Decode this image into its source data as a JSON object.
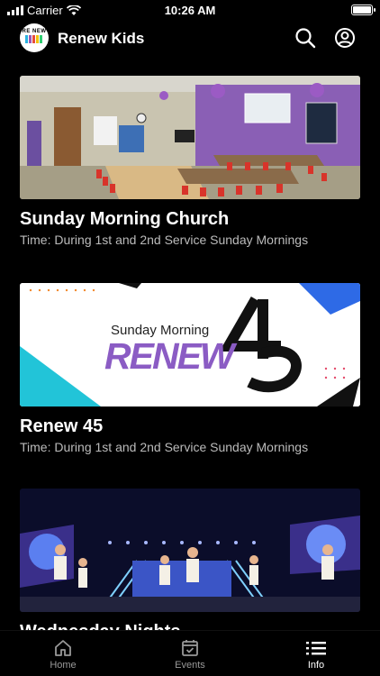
{
  "status": {
    "carrier": "Carrier",
    "time": "10:26 AM"
  },
  "header": {
    "logo_text": "RE NEW",
    "title": "Renew Kids",
    "search_icon": "search-icon",
    "account_icon": "account-icon"
  },
  "cards": [
    {
      "title": "Sunday Morning Church",
      "subtitle": "Time: During 1st and 2nd Service Sunday Mornings"
    },
    {
      "title": "Renew 45",
      "subtitle": "Time: During 1st and 2nd Service Sunday Mornings",
      "graphic": {
        "line1": "Sunday Morning",
        "word": "RENEW",
        "number": "45"
      }
    },
    {
      "title": "Wednesday Nights",
      "subtitle": ""
    }
  ],
  "tabs": [
    {
      "label": "Home",
      "icon": "home-icon"
    },
    {
      "label": "Events",
      "icon": "calendar-check-icon"
    },
    {
      "label": "Info",
      "icon": "list-icon"
    }
  ],
  "colors": {
    "background": "#000000",
    "subtitle": "#bbbbbb",
    "tab_inactive": "#999999",
    "renew_purple": "#8b5cc4"
  }
}
